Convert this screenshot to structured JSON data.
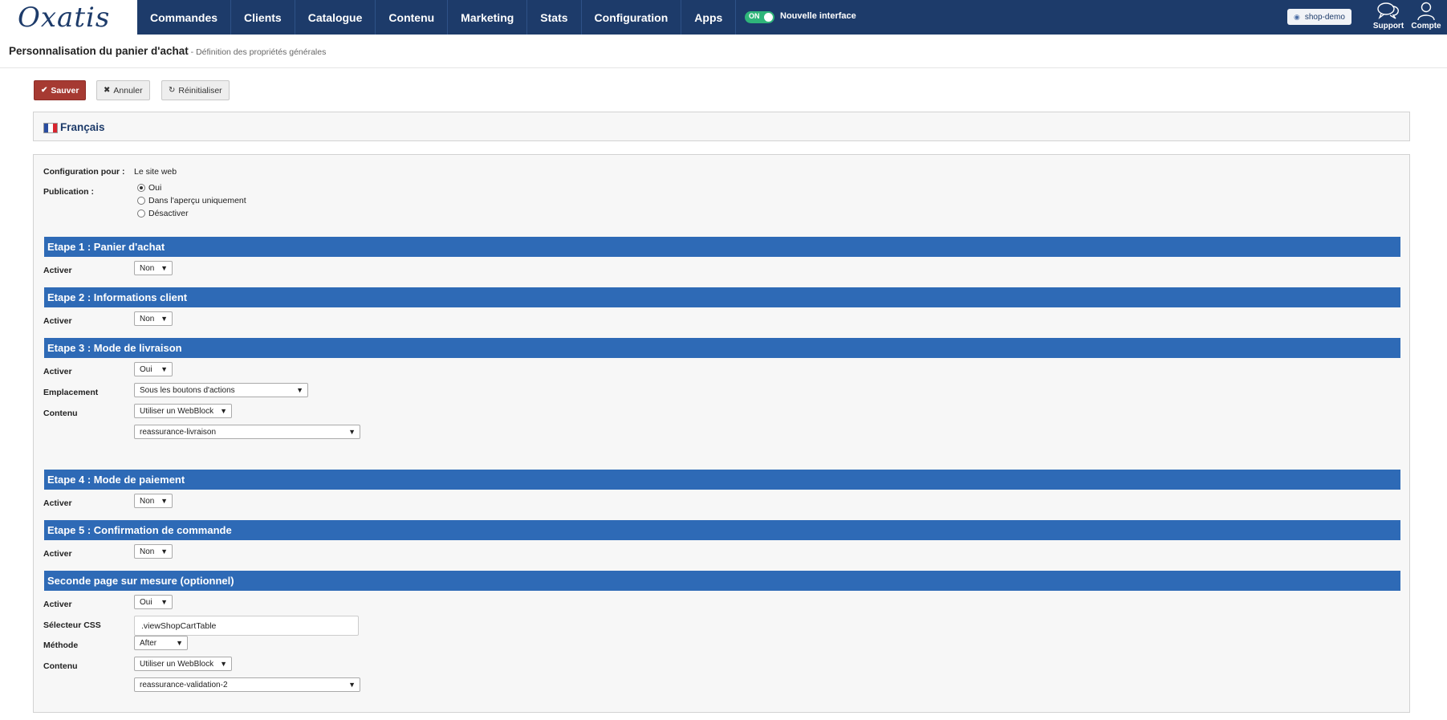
{
  "app": {
    "logo": "Oxatis",
    "nav": [
      "Commandes",
      "Clients",
      "Catalogue",
      "Contenu",
      "Marketing",
      "Stats",
      "Configuration",
      "Apps"
    ],
    "toggle_state": "ON",
    "toggle_label": "Nouvelle interface",
    "shop_name": "shop-demo",
    "support_label": "Support",
    "account_label": "Compte"
  },
  "page": {
    "title": "Personnalisation du panier d'achat",
    "subtitle": " - Définition des propriétés générales"
  },
  "actions": {
    "save": "Sauver",
    "cancel": "Annuler",
    "reset": "Réinitialiser"
  },
  "language": "Français",
  "form": {
    "config_label": "Configuration pour :",
    "config_value": "Le site web",
    "publication_label": "Publication :",
    "publication_options": [
      "Oui",
      "Dans l'aperçu uniquement",
      "Désactiver"
    ],
    "publication_selected": "Oui",
    "activer_label": "Activer",
    "emplacement_label": "Emplacement",
    "contenu_label": "Contenu",
    "selecteur_label": "Sélecteur CSS",
    "methode_label": "Méthode",
    "steps": [
      {
        "title": "Etape 1 : Panier d'achat",
        "activer": "Non"
      },
      {
        "title": "Etape 2 : Informations client",
        "activer": "Non"
      },
      {
        "title": "Etape 3 : Mode de livraison",
        "activer": "Oui",
        "emplacement": "Sous les boutons d'actions",
        "contenu": "Utiliser un WebBlock",
        "webblock": "reassurance-livraison"
      },
      {
        "title": "Etape 4 : Mode de paiement",
        "activer": "Non"
      },
      {
        "title": "Etape 5 : Confirmation de commande",
        "activer": "Non"
      },
      {
        "title": "Seconde page sur mesure (optionnel)",
        "activer": "Oui",
        "selecteur": ".viewShopCartTable",
        "methode": "After",
        "contenu": "Utiliser un WebBlock",
        "webblock": "reassurance-validation-2"
      }
    ]
  },
  "colors": {
    "nav_bg": "#1d3b6a",
    "section_bg": "#2e6ab6",
    "save_btn": "#a63a32",
    "toggle_on": "#2fb57a"
  }
}
